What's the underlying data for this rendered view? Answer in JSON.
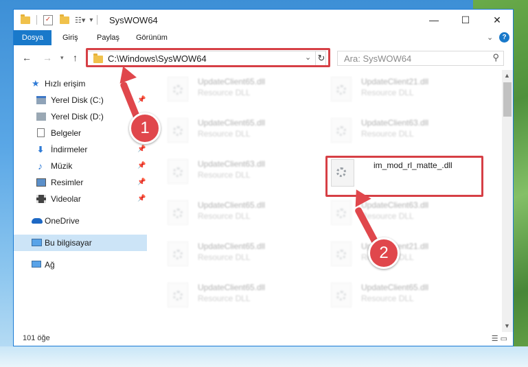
{
  "window": {
    "title": "SysWOW64"
  },
  "title_buttons": {
    "minimize": "—",
    "maximize": "☐",
    "close": "✕"
  },
  "ribbon": {
    "tabs": [
      "Dosya",
      "Giriş",
      "Paylaş",
      "Görünüm"
    ],
    "help_label": "?",
    "expand_label": "⌄"
  },
  "address": {
    "path": "C:\\Windows\\SysWOW64",
    "search_placeholder": "Ara: SysWOW64"
  },
  "nav": {
    "quick_access": "Hızlı erişim",
    "items": [
      {
        "label": "Yerel Disk (C:)",
        "pinned": true
      },
      {
        "label": "Yerel Disk (D:)",
        "pinned": false
      },
      {
        "label": "Belgeler",
        "pinned": true
      },
      {
        "label": "İndirmeler",
        "pinned": true
      },
      {
        "label": "Müzik",
        "pinned": true
      },
      {
        "label": "Resimler",
        "pinned": true
      },
      {
        "label": "Videolar",
        "pinned": true
      }
    ],
    "onedrive": "OneDrive",
    "this_pc": "Bu bilgisayar",
    "network": "Ağ"
  },
  "files": {
    "left_column": [
      {
        "name": "UpdateClient65.dll",
        "type": "Resource DLL"
      },
      {
        "name": "UpdateClient65.dll",
        "type": "Resource DLL"
      },
      {
        "name": "UpdateClient63.dll",
        "type": "Resource DLL"
      },
      {
        "name": "UpdateClient65.dll",
        "type": "Resource DLL"
      },
      {
        "name": "UpdateClient65.dll",
        "type": "Resource DLL"
      },
      {
        "name": "UpdateClient65.dll",
        "type": "Resource DLL"
      }
    ],
    "right_column": [
      {
        "name": "UpdateClient21.dll",
        "type": "Resource DLL"
      },
      {
        "name": "UpdateClient63.dll",
        "type": "Resource DLL"
      },
      {
        "name": "im_mod_rl_matte_.dll",
        "type": ""
      },
      {
        "name": "UpdateClient63.dll",
        "type": "Resource DLL"
      },
      {
        "name": "UpdateClient21.dll",
        "type": "Resource DLL"
      },
      {
        "name": "UpdateClient65.dll",
        "type": "Resource DLL"
      }
    ]
  },
  "status": {
    "count": "101 öğe"
  },
  "annotations": {
    "step1": "1",
    "step2": "2",
    "color": "#e0474c"
  }
}
